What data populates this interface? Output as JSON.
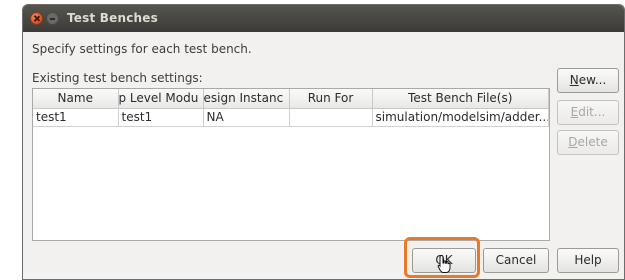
{
  "window": {
    "title": "Test Benches"
  },
  "instructions": "Specify settings for each test bench.",
  "section_label": "Existing test bench settings:",
  "table": {
    "columns": [
      "Name",
      "Top Level Module",
      "Design Instance",
      "Run For",
      "Test Bench File(s)"
    ],
    "columns_visible": [
      "Name",
      "​p Level Modu",
      "​esign Instanc",
      "Run For",
      "Test Bench File(s)"
    ],
    "rows": [
      {
        "name": "test1",
        "top_level_module": "test1",
        "design_instance": "NA",
        "run_for": "",
        "test_bench_files": "simulation/modelsim/adder..."
      }
    ]
  },
  "buttons": {
    "new": {
      "label_mnemonic": "N",
      "label_rest": "ew..."
    },
    "edit": {
      "label_mnemonic": "E",
      "label_rest": "dit..."
    },
    "delete": {
      "label_mnemonic": "D",
      "label_rest": "elete"
    },
    "ok": "OK",
    "cancel": "Cancel",
    "help": "Help"
  },
  "colors": {
    "titlebar": "#3c3b37",
    "highlight": "#e8792b",
    "close_button": "#e0552a"
  }
}
